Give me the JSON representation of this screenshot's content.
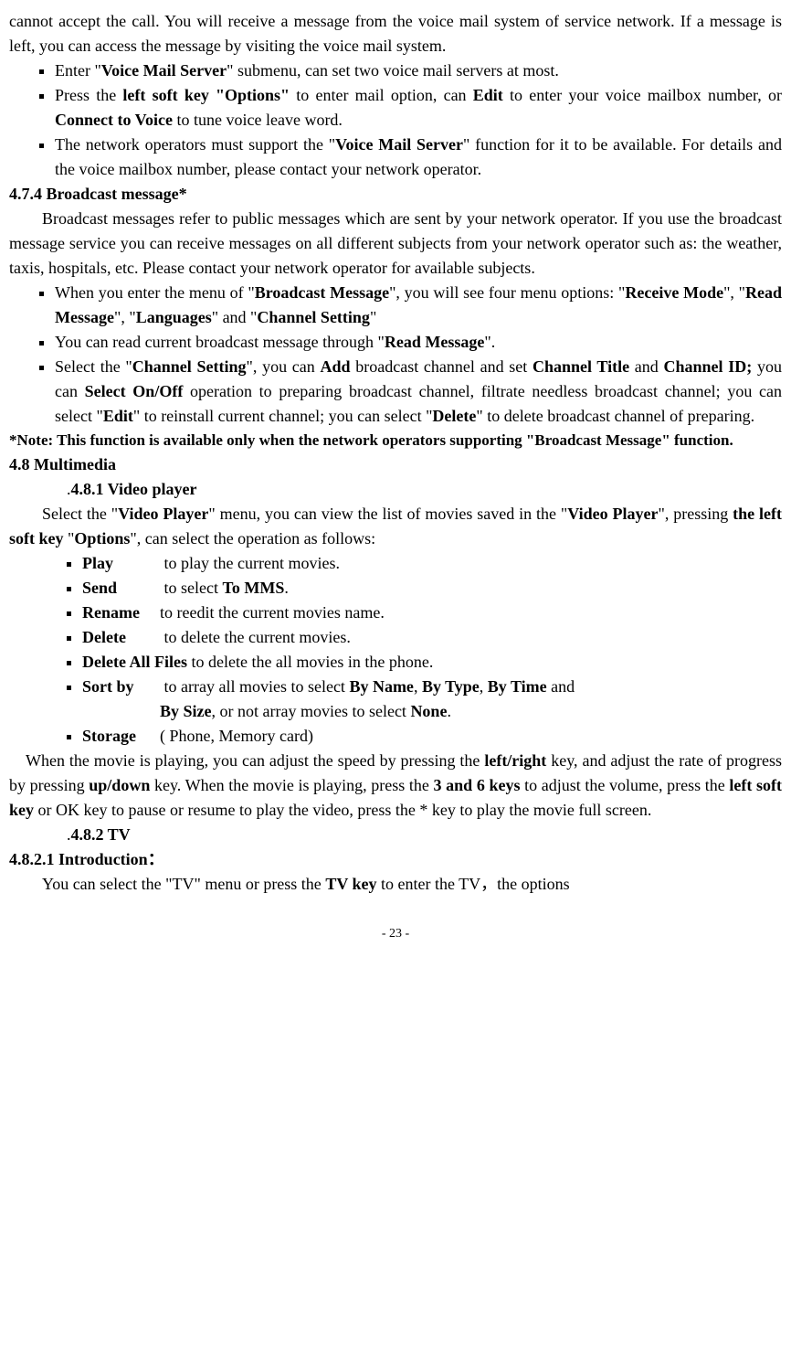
{
  "intro": {
    "p1": "cannot accept the call. You will receive a message from the voice mail system of service network. If a message is left, you can access the message by visiting the voice mail system."
  },
  "voicemail_list": {
    "i1_a": "Enter \"",
    "i1_b": "Voice Mail Server",
    "i1_c": "\" submenu, can set two voice mail servers at most.",
    "i2_a": "Press the ",
    "i2_b": "left soft key \"Options\"",
    "i2_c": " to enter mail option, can ",
    "i2_d": "Edit",
    "i2_e": " to enter your voice mailbox number, or ",
    "i2_f": "Connect to Voice",
    "i2_g": " to tune voice leave word.",
    "i3_a": "The network operators must support the \"",
    "i3_b": "Voice Mail Server",
    "i3_c": "\" function for it to be available. For details and the voice mailbox number, please contact your network operator."
  },
  "h474": "4.7.4 Broadcast message*",
  "broadcast": {
    "p1": "Broadcast messages refer to public messages which are sent by your network operator. If you use the broadcast message service you can receive messages on all different subjects from your network operator such as: the weather, taxis, hospitals, etc. Please contact your network operator for available subjects."
  },
  "broadcast_list": {
    "i1_a": "When you enter the menu of \"",
    "i1_b": "Broadcast Message",
    "i1_c": "\", you will see four menu options: \"",
    "i1_d": "Receive Mode",
    "i1_e": "\", \"",
    "i1_f": "Read Message",
    "i1_g": "\", \"",
    "i1_h": "Languages",
    "i1_i": "\" and \"",
    "i1_j": "Channel Setting",
    "i1_k": "\"",
    "i2_a": "You can read current broadcast message through \"",
    "i2_b": "Read Message",
    "i2_c": "\".",
    "i3_a": "Select the \"",
    "i3_b": "Channel Setting",
    "i3_c": "\", you can ",
    "i3_d": "Add",
    "i3_e": " broadcast channel and set ",
    "i3_f": "Channel Title",
    "i3_g": " and ",
    "i3_h": "Channel ID;",
    "i3_i": " you can ",
    "i3_j": "Select On/Off",
    "i3_k": " operation to preparing broadcast channel, filtrate needless broadcast channel; you can select \"",
    "i3_l": "Edit",
    "i3_m": "\" to reinstall current channel; you can select \"",
    "i3_n": "Delete",
    "i3_o": "\" to delete broadcast channel of preparing."
  },
  "note": "*Note:   This function is available only when the network operators supporting \"Broadcast Message\" function.",
  "h48": "4.8 Multimedia",
  "h481": "4.8.1 Video player",
  "video": {
    "p1_a": "Select the \"",
    "p1_b": "Video Player",
    "p1_c": "\" menu, you can view the list of movies saved in the \"",
    "p1_d": "Video Player",
    "p1_e": "\", pressing ",
    "p1_f": "the left soft key",
    "p1_g": " \"",
    "p1_h": "Options",
    "p1_i": "\", can select the operation as follows:"
  },
  "options": {
    "play_l": "Play",
    "play_d": "   to play the current movies.",
    "send_l": "Send",
    "send_d_a": "  to select ",
    "send_d_b": "To MMS",
    "send_d_c": ".",
    "rename_l": "Rename",
    "rename_d": "to reedit the current movies name.",
    "delete_l": "Delete",
    "delete_d": "  to delete the current movies.",
    "delall_l": "Delete All Files",
    "delall_d": " to delete the all movies in the phone.",
    "sort_l": "Sort by",
    "sort_d_a": " to array all movies to select ",
    "sort_d_b": "By Name",
    "sort_d_c": ", ",
    "sort_d_d": "By Type",
    "sort_d_e": ", ",
    "sort_d_f": "By Time",
    "sort_d_g": " and ",
    "sort_d_h": "By Size",
    "sort_d_i": ", or not array movies to select ",
    "sort_d_j": "None",
    "sort_d_k": ".",
    "storage_l": "Storage",
    "storage_d": "( Phone, Memory card)"
  },
  "video2": {
    "p1_a": "When the movie is playing, you can adjust the speed by pressing the ",
    "p1_b": "left/right",
    "p1_c": " key, and adjust the rate of progress by pressing ",
    "p1_d": "up/down",
    "p1_e": " key. When the movie is playing, press the ",
    "p1_f": "3 and 6 keys",
    "p1_g": " to adjust the volume, press the ",
    "p1_h": "left soft key",
    "p1_i": " or OK key to pause or resume to play the video, press the * key to play the movie full screen."
  },
  "h482": "4.8.2 TV",
  "h4821": "4.8.2.1 Introduction：",
  "tv": {
    "p1_a": "You can select the \"TV\" menu or press the ",
    "p1_b": "TV key",
    "p1_c": " to enter the TV，the options"
  },
  "footer": "- 23 -"
}
